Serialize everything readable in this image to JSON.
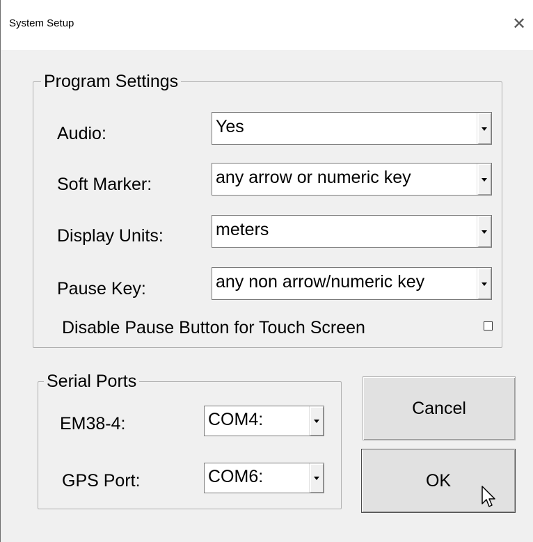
{
  "window": {
    "title": "System Setup",
    "close_glyph": "✕"
  },
  "program_settings": {
    "legend": "Program Settings",
    "audio": {
      "label": "Audio:",
      "value": "Yes"
    },
    "soft_marker": {
      "label": "Soft Marker:",
      "value": "any arrow or numeric key"
    },
    "display_units": {
      "label": "Display Units:",
      "value": "meters"
    },
    "pause_key": {
      "label": "Pause Key:",
      "value": "any non arrow/numeric key"
    },
    "disable_pause": {
      "label": "Disable Pause Button for Touch Screen",
      "checked": false
    }
  },
  "serial_ports": {
    "legend": "Serial Ports",
    "em38": {
      "label": "EM38-4:",
      "value": "COM4:"
    },
    "gps": {
      "label": "GPS Port:",
      "value": "COM6:"
    }
  },
  "buttons": {
    "cancel": "Cancel",
    "ok": "OK"
  },
  "icons": {
    "close": "close-icon",
    "dropdown": "chevron-down-icon",
    "cursor": "mouse-pointer-icon"
  }
}
